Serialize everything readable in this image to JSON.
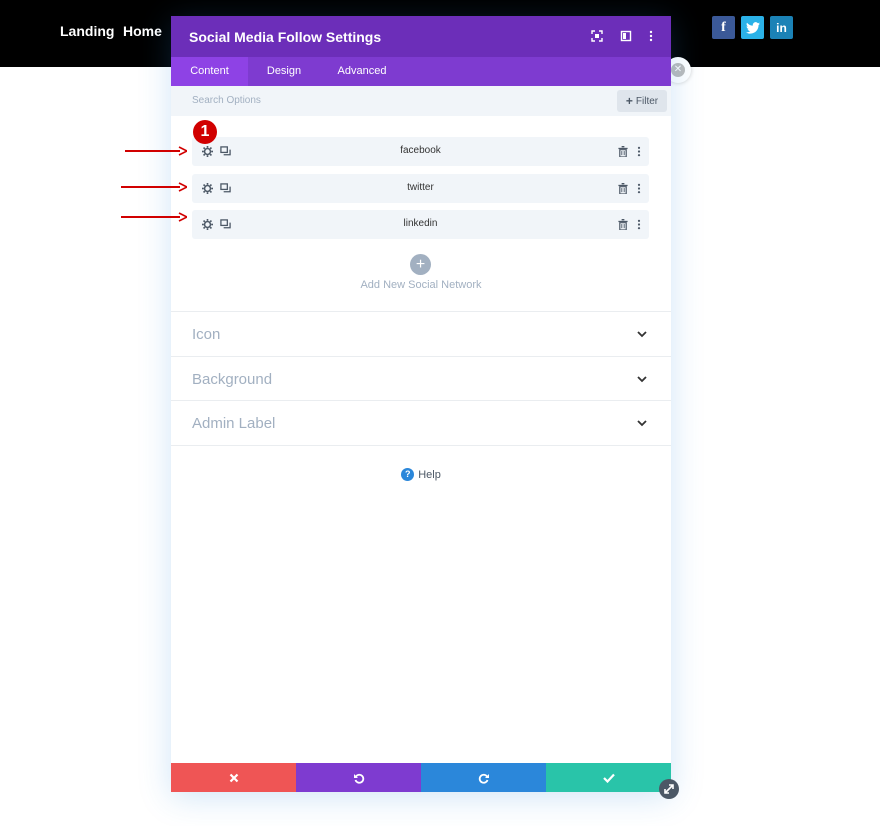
{
  "site": {
    "nav": [
      "Landing",
      "Home"
    ],
    "social": [
      {
        "icon": "facebook-icon",
        "glyph": "f",
        "color": "#3b5998"
      },
      {
        "icon": "twitter-icon",
        "color": "#2bb2e8"
      },
      {
        "icon": "linkedin-icon",
        "glyph": "in",
        "color": "#1b82b6"
      }
    ]
  },
  "modal": {
    "title": "Social Media Follow Settings",
    "tabs": [
      {
        "label": "Content",
        "active": true
      },
      {
        "label": "Design",
        "active": false
      },
      {
        "label": "Advanced",
        "active": false
      }
    ],
    "search_placeholder": "Search Options",
    "filter_label": "Filter",
    "filter_plus": "+",
    "networks": [
      {
        "label": "facebook"
      },
      {
        "label": "twitter"
      },
      {
        "label": "linkedin"
      }
    ],
    "badge": "1",
    "add_plus": "+",
    "add_label": "Add New Social Network",
    "toggles": [
      {
        "label": "Icon"
      },
      {
        "label": "Background"
      },
      {
        "label": "Admin Label"
      }
    ],
    "help_label": "Help",
    "help_glyph": "?"
  },
  "colors": {
    "header_purple": "#6c2eb9",
    "tab_purple": "#7e3bd0",
    "cancel": "#ef5555",
    "undo": "#7e3bd0",
    "redo": "#2b87da",
    "save": "#29c4a9",
    "annotation_red": "#d10000"
  }
}
